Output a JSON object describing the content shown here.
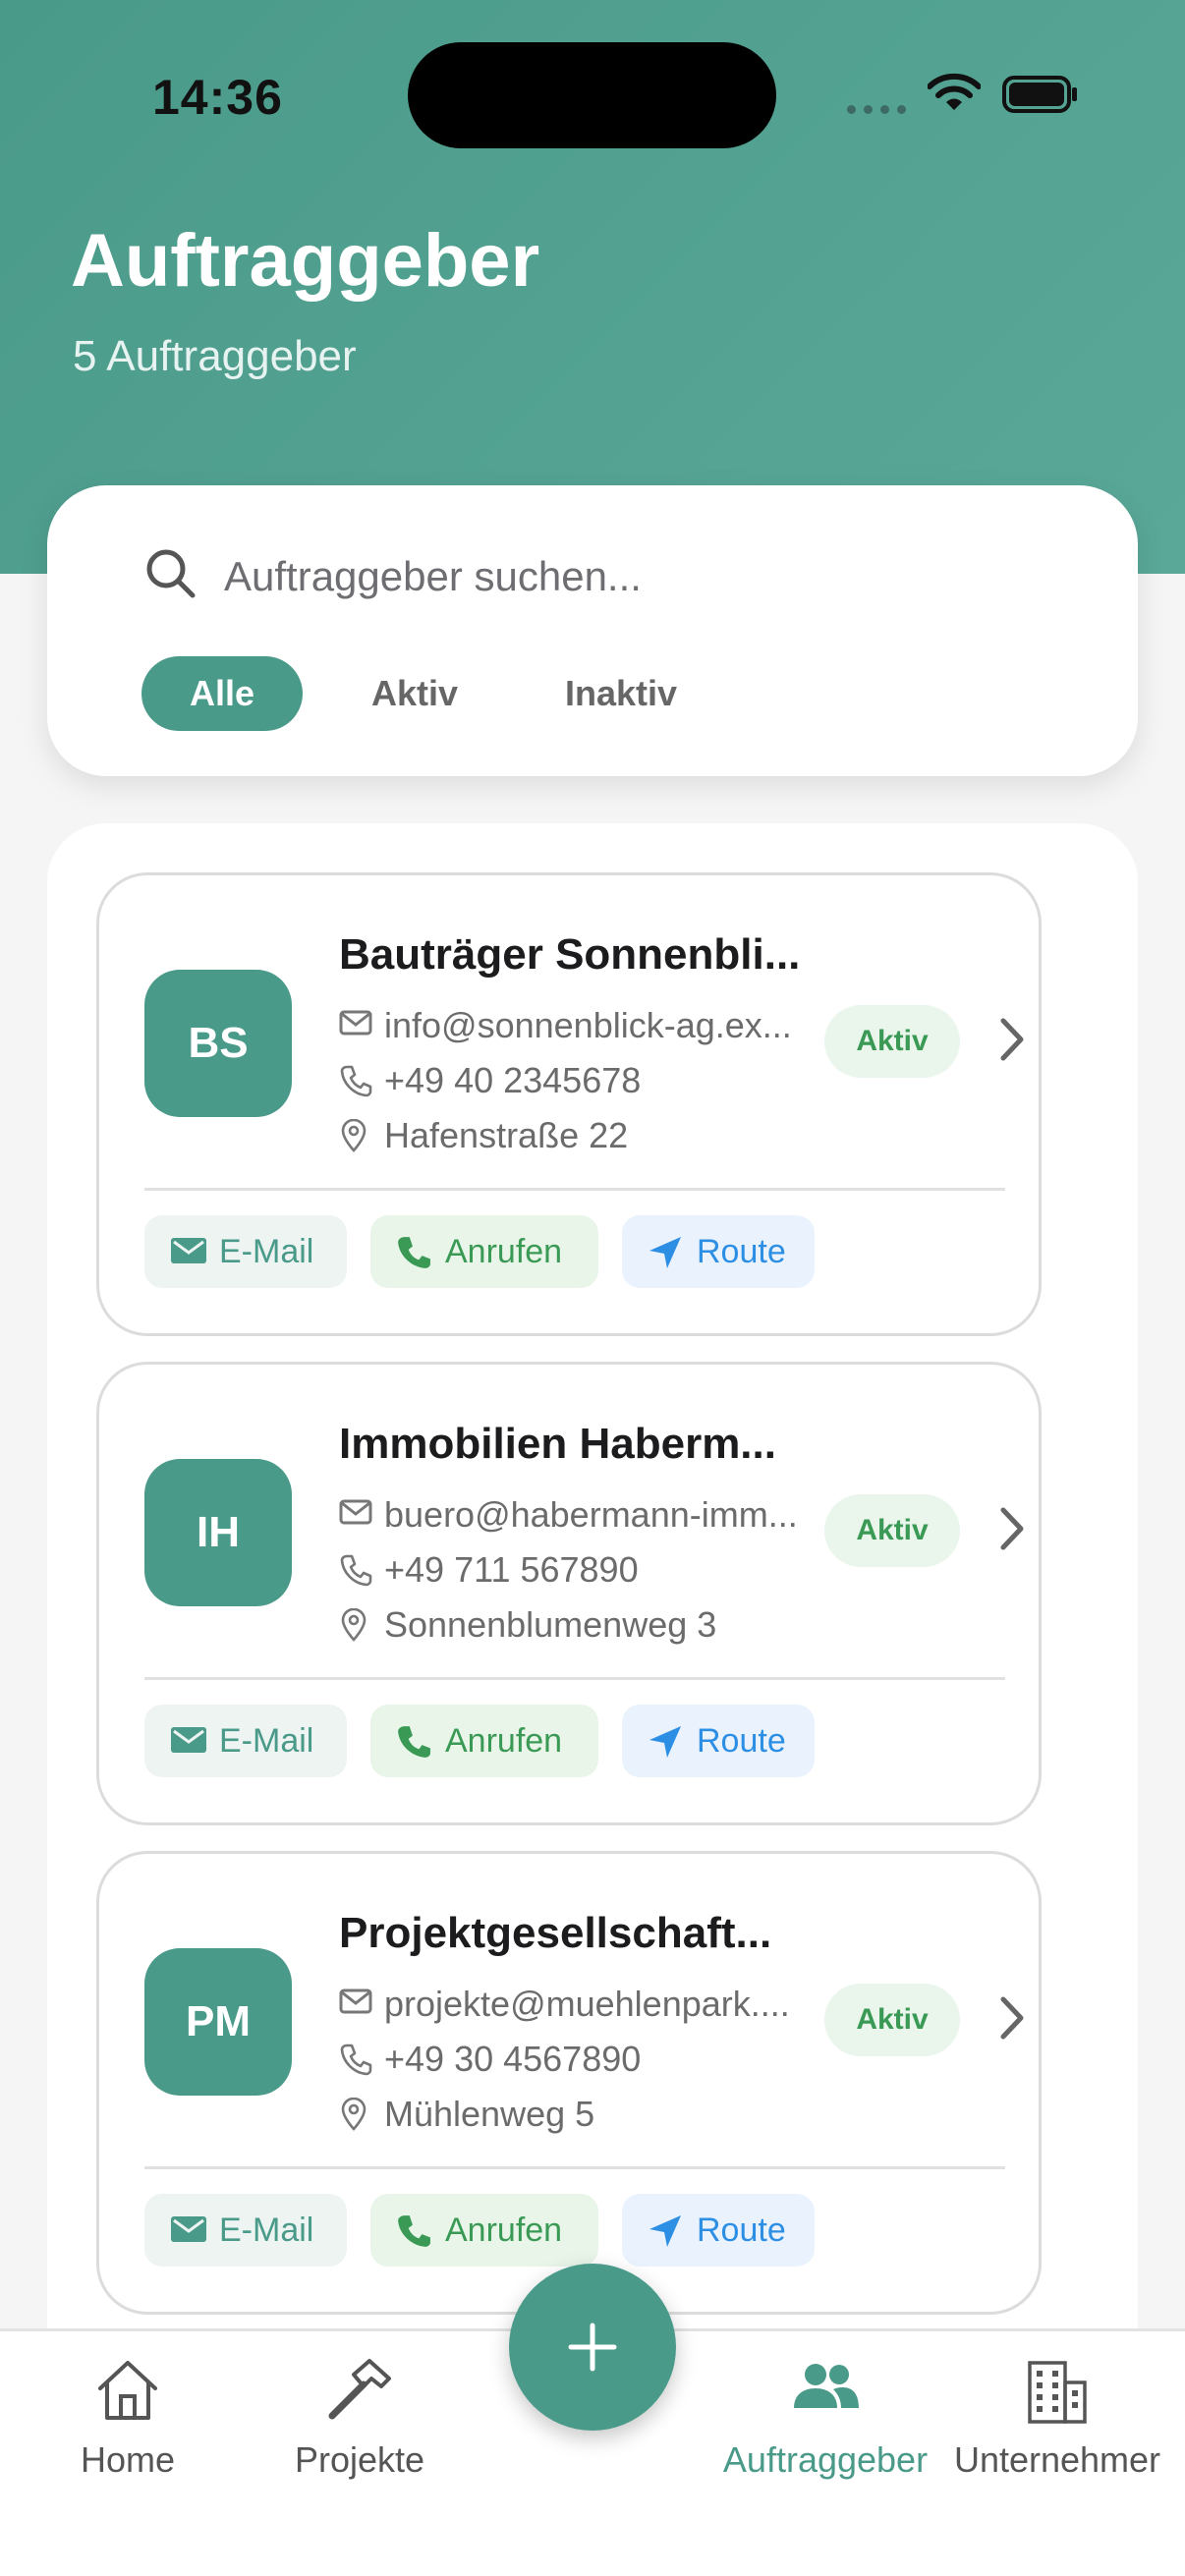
{
  "status_bar": {
    "time": "14:36"
  },
  "header": {
    "title": "Auftraggeber",
    "subtitle": "5 Auftraggeber"
  },
  "search": {
    "placeholder": "Auftraggeber suchen...",
    "value": ""
  },
  "filters": [
    {
      "label": "Alle",
      "active": true
    },
    {
      "label": "Aktiv",
      "active": false
    },
    {
      "label": "Inaktiv",
      "active": false
    }
  ],
  "clients": [
    {
      "initials": "BS",
      "name": "Bauträger Sonnenbli...",
      "email": "info@sonnenblick-ag.ex...",
      "phone": "+49 40 2345678",
      "address": "Hafenstraße 22",
      "status": "Aktiv"
    },
    {
      "initials": "IH",
      "name": "Immobilien Haberm...",
      "email": "buero@habermann-imm...",
      "phone": "+49 711 567890",
      "address": "Sonnenblumenweg 3",
      "status": "Aktiv"
    },
    {
      "initials": "PM",
      "name": "Projektgesellschaft...",
      "email": "projekte@muehlenpark....",
      "phone": "+49 30 4567890",
      "address": "Mühlenweg 5",
      "status": "Aktiv"
    }
  ],
  "actions": {
    "email": "E-Mail",
    "call": "Anrufen",
    "route": "Route"
  },
  "tabs": [
    {
      "label": "Home",
      "icon": "home-icon",
      "active": false
    },
    {
      "label": "Projekte",
      "icon": "hammer-icon",
      "active": false
    },
    {
      "label": "Auftraggeber",
      "icon": "people-icon",
      "active": true
    },
    {
      "label": "Unternehmer",
      "icon": "building-icon",
      "active": false
    }
  ],
  "colors": {
    "primary": "#4a9a8a",
    "active_badge_bg": "#eaf5ec",
    "active_badge_text": "#3a9a55",
    "route": "#2d8fe4"
  }
}
